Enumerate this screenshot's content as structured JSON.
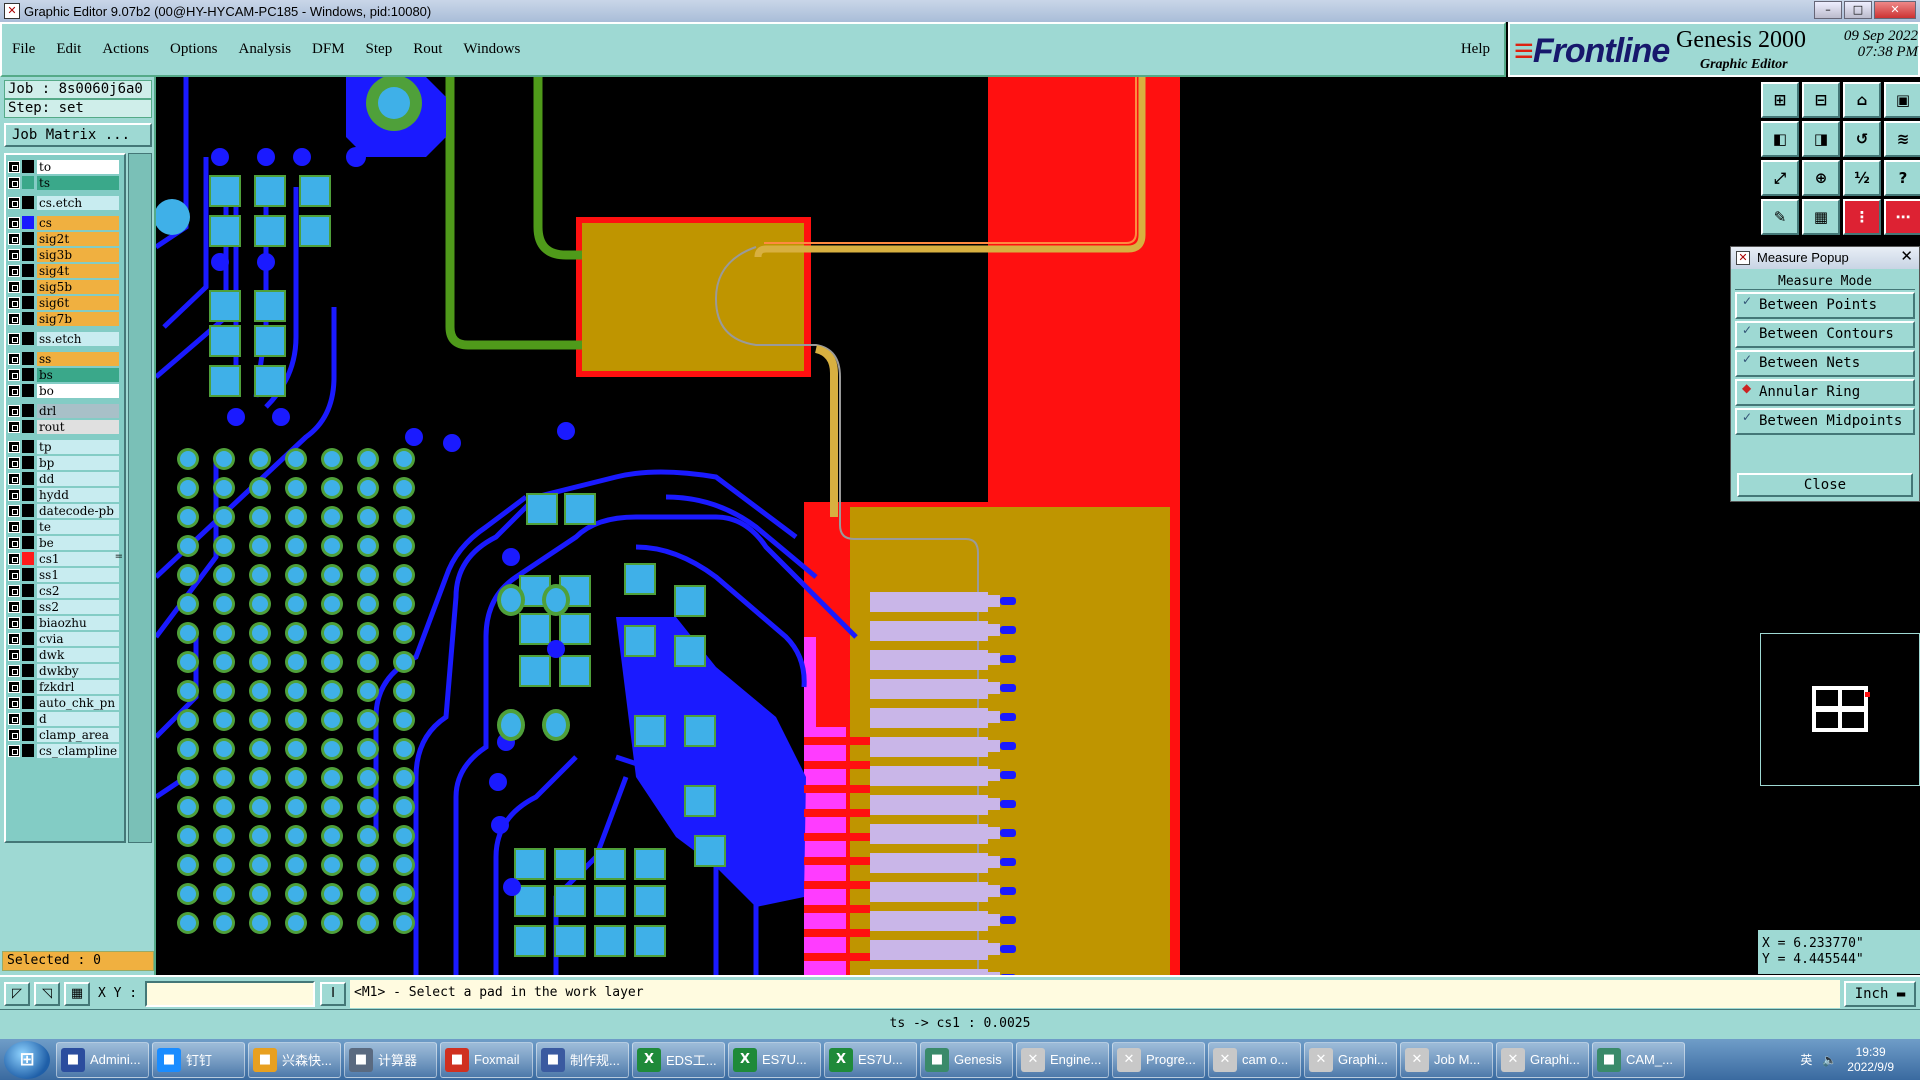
{
  "window": {
    "title": "Graphic Editor 9.07b2 (00@HY-HYCAM-PC185 - Windows, pid:10080)"
  },
  "menu": {
    "items": [
      "File",
      "Edit",
      "Actions",
      "Options",
      "Analysis",
      "DFM",
      "Step",
      "Rout",
      "Windows"
    ],
    "help": "Help"
  },
  "brand": {
    "logo": "Frontline",
    "product": "Genesis 2000",
    "subtitle": "Graphic Editor",
    "date": "09 Sep 2022",
    "time": "07:38 PM"
  },
  "job": {
    "job_line": "Job : 8s0060j6a0",
    "step_line": "Step: set",
    "matrix_button": "Job Matrix ...",
    "selected": "Selected : 0"
  },
  "layers": [
    {
      "name": "to",
      "color": "#ffffff"
    },
    {
      "name": "ts",
      "color": "#3aa88a"
    },
    {
      "name": "cs.etch",
      "color": "#c8ecf0"
    },
    {
      "name": "cs",
      "color": "#f0b040"
    },
    {
      "name": "sig2t",
      "color": "#f0b040"
    },
    {
      "name": "sig3b",
      "color": "#f0b040"
    },
    {
      "name": "sig4t",
      "color": "#f0b040"
    },
    {
      "name": "sig5b",
      "color": "#f0b040"
    },
    {
      "name": "sig6t",
      "color": "#f0b040"
    },
    {
      "name": "sig7b",
      "color": "#f0b040"
    },
    {
      "name": "ss.etch",
      "color": "#c8ecf0"
    },
    {
      "name": "ss",
      "color": "#f0b040"
    },
    {
      "name": "bs",
      "color": "#3aa88a"
    },
    {
      "name": "bo",
      "color": "#ffffff"
    },
    {
      "name": "drl",
      "color": "#a8c0c8"
    },
    {
      "name": "rout",
      "color": "#e0e0e0"
    },
    {
      "name": "tp",
      "color": "#c8ecf0"
    },
    {
      "name": "bp",
      "color": "#c8ecf0"
    },
    {
      "name": "dd",
      "color": "#c8ecf0"
    },
    {
      "name": "hydd",
      "color": "#c8ecf0"
    },
    {
      "name": "datecode-pb",
      "color": "#c8ecf0"
    },
    {
      "name": "te",
      "color": "#c8ecf0"
    },
    {
      "name": "be",
      "color": "#c8ecf0"
    },
    {
      "name": "cs1",
      "color": "#c8ecf0",
      "flag": "="
    },
    {
      "name": "ss1",
      "color": "#c8ecf0"
    },
    {
      "name": "cs2",
      "color": "#c8ecf0"
    },
    {
      "name": "ss2",
      "color": "#c8ecf0"
    },
    {
      "name": "biaozhu",
      "color": "#c8ecf0"
    },
    {
      "name": "cvia",
      "color": "#c8ecf0"
    },
    {
      "name": "dwk",
      "color": "#c8ecf0"
    },
    {
      "name": "dwkby",
      "color": "#c8ecf0"
    },
    {
      "name": "fzkdrl",
      "color": "#c8ecf0"
    },
    {
      "name": "auto_chk_pn",
      "color": "#c8ecf0"
    },
    {
      "name": "d",
      "color": "#c8ecf0"
    },
    {
      "name": "clamp_area",
      "color": "#c8ecf0"
    },
    {
      "name": "cs_clampline",
      "color": "#c8ecf0"
    }
  ],
  "layer_swatches": {
    "ts": "#3aa88a",
    "cs": "#1a1aff",
    "cs1": "#ff1a1a"
  },
  "measure": {
    "title": "Measure Popup",
    "mode_label": "Measure Mode",
    "options": [
      {
        "label": "Between Points",
        "active": false
      },
      {
        "label": "Between Contours",
        "active": false
      },
      {
        "label": "Between Nets",
        "active": false
      },
      {
        "label": "Annular Ring",
        "active": true
      },
      {
        "label": "Between Midpoints",
        "active": false
      }
    ],
    "close": "Close"
  },
  "coords": {
    "x": "X = 6.233770\"",
    "y": "Y = 4.445544\""
  },
  "command": {
    "xy_label": "X Y :",
    "xy_value": "",
    "prompt": "<M1> - Select a pad in the work layer",
    "unit": "Inch"
  },
  "status": "ts -> cs1 : 0.0025",
  "colors": {
    "pad_cyan": "#3fb0e8",
    "pad_green": "#4fa03a",
    "trace_blue": "#1a1aff",
    "copper_red": "#ff1010",
    "copper_gold": "#bf9500",
    "lavender": "#c9b6e8",
    "magenta": "#ff3cff",
    "green_trace": "#4f9a1a",
    "ui_teal": "#9ed9d3"
  },
  "taskbar": {
    "tasks": [
      {
        "label": "Admini...",
        "icon": "floppy-icon",
        "color": "#2b4d9e"
      },
      {
        "label": "钉钉",
        "icon": "dingtalk-icon",
        "color": "#1a8cff"
      },
      {
        "label": "兴森快...",
        "icon": "sun-icon",
        "color": "#e8a020"
      },
      {
        "label": "计算器",
        "icon": "calculator-icon",
        "color": "#5a6a80"
      },
      {
        "label": "Foxmail",
        "icon": "foxmail-icon",
        "color": "#d03020"
      },
      {
        "label": "制作规...",
        "icon": "document-icon",
        "color": "#3a5aa0"
      },
      {
        "label": "EDS工...",
        "icon": "excel-icon",
        "color": "#1f8a3a"
      },
      {
        "label": "ES7U...",
        "icon": "excel-icon",
        "color": "#1f8a3a"
      },
      {
        "label": "ES7U...",
        "icon": "excel-icon",
        "color": "#1f8a3a"
      },
      {
        "label": "Genesis",
        "icon": "genesis-icon",
        "color": "#3a8a6a"
      },
      {
        "label": "Engine...",
        "icon": "x-window-icon",
        "color": "#c8c8c8"
      },
      {
        "label": "Progre...",
        "icon": "x-window-icon",
        "color": "#c8c8c8"
      },
      {
        "label": "cam o...",
        "icon": "x-window-icon",
        "color": "#c8c8c8"
      },
      {
        "label": "Graphi...",
        "icon": "x-window-icon",
        "color": "#c8c8c8"
      },
      {
        "label": "Job M...",
        "icon": "x-window-icon",
        "color": "#c8c8c8"
      },
      {
        "label": "Graphi...",
        "icon": "x-window-icon",
        "color": "#c8c8c8"
      },
      {
        "label": "CAM_...",
        "icon": "genesis-icon",
        "color": "#3a8a6a"
      }
    ],
    "ime": "英",
    "time": "19:39",
    "date": "2022/9/9"
  }
}
